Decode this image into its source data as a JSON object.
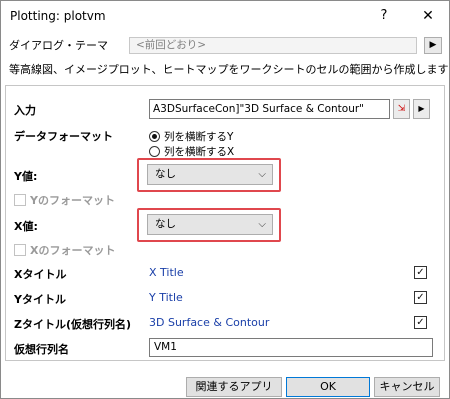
{
  "window": {
    "title": "Plotting: plotvm",
    "help_glyph": "?",
    "close_glyph": "✕"
  },
  "theme": {
    "label": "ダイアログ・テーマ",
    "value": "<前回どおり>",
    "arrow": "▶"
  },
  "description": "等高線図、イメージプロット、ヒートマップをワークシートのセルの範囲から作成します",
  "input": {
    "label": "入力",
    "value": "A3DSurfaceCon]\"3D Surface & Contour\"",
    "pick_icon": "⇲",
    "arrow": "▶"
  },
  "data_format": {
    "label": "データフォーマット",
    "options": [
      {
        "label": "列を横断するY",
        "selected": true
      },
      {
        "label": "列を横断するX",
        "selected": false
      }
    ]
  },
  "y_values": {
    "label": "Y値:",
    "value": "なし",
    "chevron": "⌵"
  },
  "y_format": {
    "label": "Yのフォーマット",
    "checked": false
  },
  "x_values": {
    "label": "X値:",
    "value": "なし",
    "chevron": "⌵"
  },
  "x_format": {
    "label": "Xのフォーマット",
    "checked": false
  },
  "x_title": {
    "label": "Xタイトル",
    "value": "X Title",
    "checked": true
  },
  "y_title": {
    "label": "Yタイトル",
    "value": "Y Title",
    "checked": true
  },
  "z_title": {
    "label": "Zタイトル(仮想行列名)",
    "value": "3D Surface & Contour",
    "checked": true
  },
  "vm_name": {
    "label": "仮想行列名",
    "value": "VM1"
  },
  "buttons": {
    "related_apps": "関連するアプリ",
    "ok": "OK",
    "cancel": "キャンセル"
  },
  "colors": {
    "highlight": "#e0474d",
    "link_text": "#1a3fa8"
  },
  "check_glyph": "✓"
}
